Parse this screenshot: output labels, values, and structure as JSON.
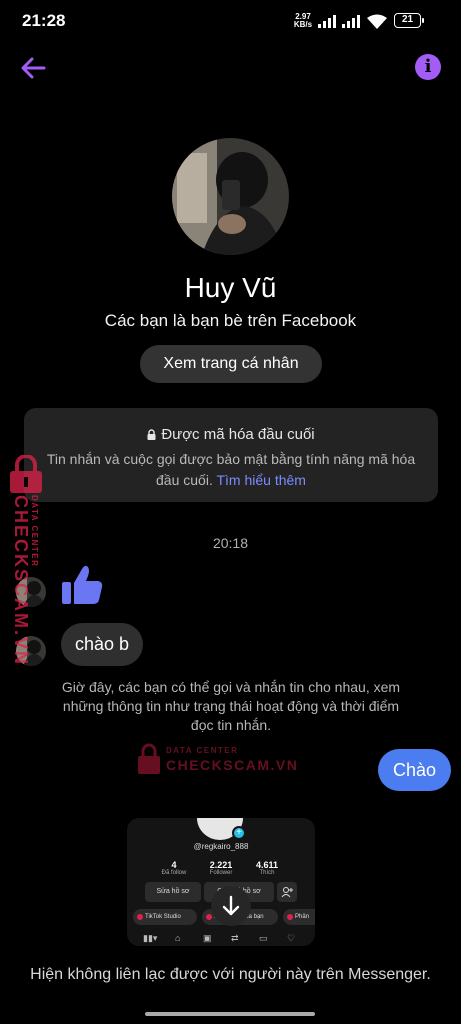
{
  "status_bar": {
    "time": "21:28",
    "net_speed_value": "2.97",
    "net_speed_unit": "KB/s",
    "battery": "21"
  },
  "header": {
    "back_icon": "arrow-left-icon",
    "info_icon": "info-icon",
    "info_glyph": "i"
  },
  "profile": {
    "name": "Huy Vũ",
    "subtitle": "Các bạn là bạn bè trên Facebook",
    "view_profile_label": "Xem trang cá nhân"
  },
  "encryption": {
    "title": "Được mã hóa đầu cuối",
    "body": "Tin nhắn và cuộc gọi được bảo mật bằng tính năng mã hóa đầu cuối.",
    "link": "Tìm hiểu thêm"
  },
  "conversation": {
    "timestamp": "20:18",
    "messages": [
      {
        "sender": "them",
        "type": "like",
        "icon": "thumbs-up-icon"
      },
      {
        "sender": "them",
        "type": "text",
        "text": "chào b"
      },
      {
        "sender": "system",
        "type": "note",
        "text": "Giờ đây, các bạn có thể gọi và nhắn tin cho nhau, xem những thông tin như trạng thái hoạt động và thời điểm đọc tin nhắn."
      },
      {
        "sender": "me",
        "type": "text",
        "text": "Chào"
      }
    ]
  },
  "shared_image": {
    "handle": "@regkairo_888",
    "stats": [
      {
        "value": "4",
        "label": "Đã follow"
      },
      {
        "value": "2.221",
        "label": "Follower"
      },
      {
        "value": "4.611",
        "label": "Thích"
      }
    ],
    "buttons": [
      "Sửa hồ sơ",
      "Chia sẻ hồ sơ"
    ],
    "chips": [
      "TikTok Studio",
      "Đơn hàng của bạn",
      "Phân"
    ]
  },
  "watermark": {
    "sub": "DATA CENTER",
    "brand": "CHECKSCAM.VN"
  },
  "footer": {
    "note": "Hiện không liên lạc được với người này trên Messenger."
  },
  "colors": {
    "accent": "#a35cf5",
    "outgoing_bubble": "#4b7df0",
    "incoming_bubble": "#2f2f2f",
    "like": "#6b76f2",
    "watermark": "#e0224a"
  }
}
